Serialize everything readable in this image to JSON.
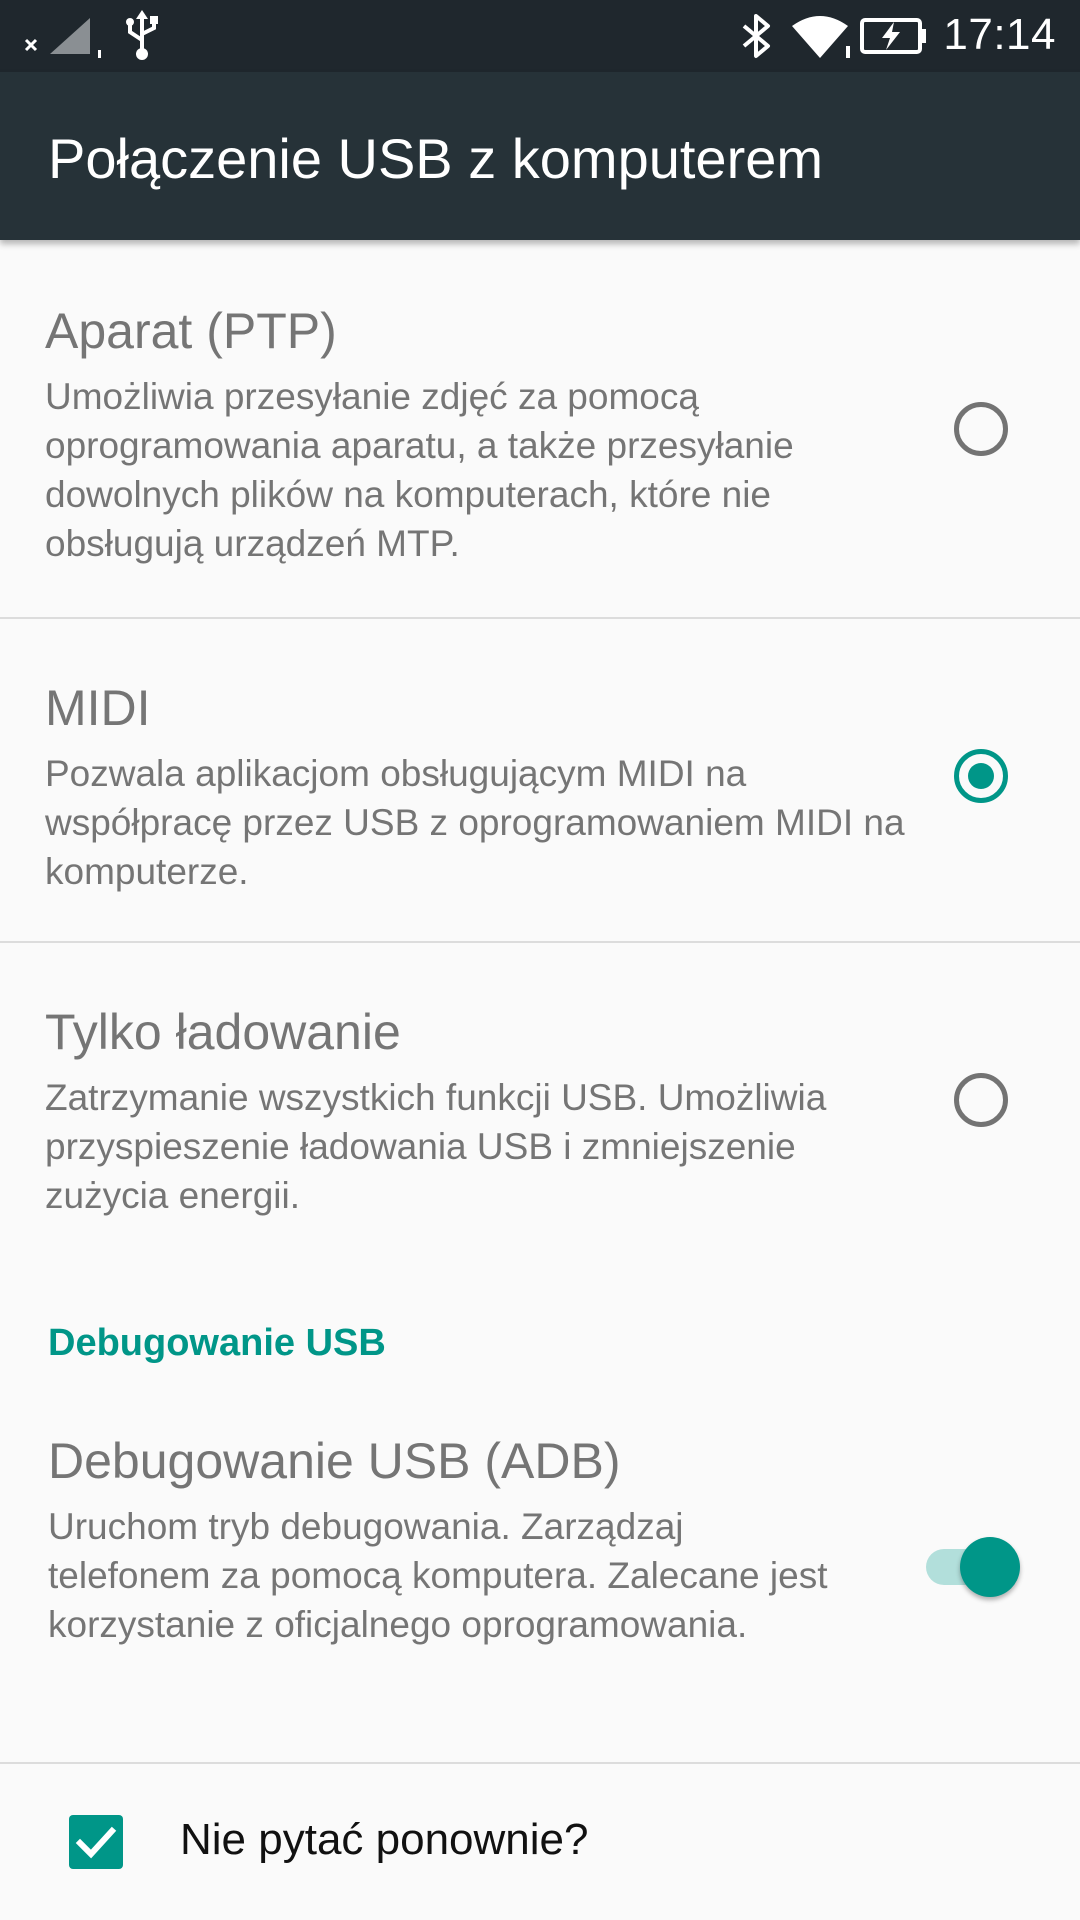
{
  "status_bar": {
    "time": "17:14",
    "icons": [
      "no-signal-icon",
      "usb-icon",
      "bluetooth-icon",
      "wifi-icon",
      "battery-charging-icon"
    ]
  },
  "app_bar": {
    "title": "Połączenie USB z komputerem"
  },
  "options": [
    {
      "title": "Aparat (PTP)",
      "description": "Umożliwia przesyłanie zdjęć za pomocą oprogramowania aparatu, a także przesyłanie dowolnych plików na komputerach, które nie obsługują urządzeń MTP.",
      "selected": false
    },
    {
      "title": "MIDI",
      "description": "Pozwala aplikacjom obsługującym MIDI na współpracę przez USB z oprogramowaniem MIDI na komputerze.",
      "selected": true
    },
    {
      "title": "Tylko ładowanie",
      "description": "Zatrzymanie wszystkich funkcji USB. Umożliwia przyspieszenie ładowania USB i zmniejszenie zużycia energii.",
      "selected": false
    }
  ],
  "debug_section": {
    "header": "Debugowanie USB",
    "title": "Debugowanie USB (ADB)",
    "description": "Uruchom tryb debugowania. Zarządzaj telefonem za pomocą komputera. Zalecane jest korzystanie z oficjalnego oprogramowania.",
    "enabled": true
  },
  "dont_ask": {
    "label": "Nie pytać ponownie?",
    "checked": true
  },
  "colors": {
    "accent": "#009688",
    "app_bar": "#263238",
    "status_bar": "#1f272d"
  }
}
